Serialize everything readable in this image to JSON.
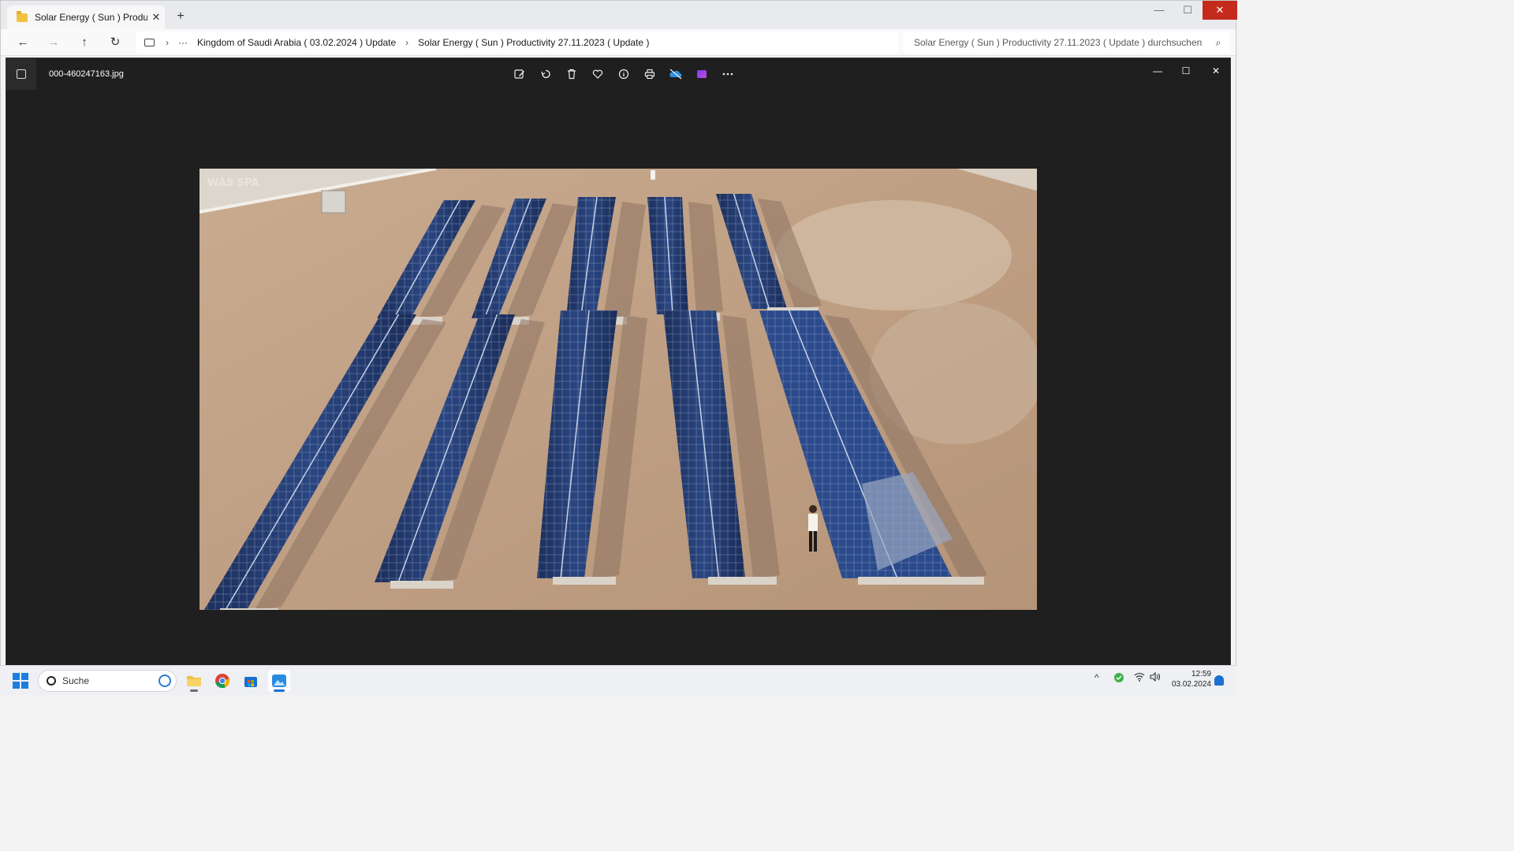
{
  "explorer": {
    "tab_title": "Solar Energy ( Sun ) Productivi",
    "window_controls": {
      "min": "—",
      "max": "☐",
      "close": "✕"
    },
    "nav": {
      "back": "←",
      "forward": "→",
      "up": "↑",
      "refresh": "↻",
      "more": "···"
    },
    "breadcrumbs": [
      "Kingdom of Saudi Arabia ( 03.02.2024 ) Update",
      "Solar Energy ( Sun ) Productivity 27.11.2023 ( Update )"
    ],
    "search_placeholder": "Solar Energy ( Sun ) Productivity 27.11.2023 ( Update ) durchsuchen"
  },
  "viewer": {
    "filename": "000-460247163.jpg",
    "toolbar": [
      "edit-icon",
      "rotate-icon",
      "delete-icon",
      "favorite-icon",
      "info-icon",
      "print-icon",
      "onedrive-icon",
      "clipchamp-icon",
      "more-icon"
    ],
    "window_controls": {
      "min": "—",
      "max": "☐",
      "close": "✕"
    },
    "watermark": "WAS SPA"
  },
  "taskbar": {
    "search_label": "Suche",
    "time": "12:59",
    "date": "03.02.2024",
    "apps": [
      "file-explorer-icon",
      "chrome-icon",
      "store-icon",
      "photos-icon"
    ]
  },
  "colors": {
    "close_red": "#c42b1c",
    "accent": "#1b6fd1",
    "viewer_bg": "#1f1f1f"
  }
}
